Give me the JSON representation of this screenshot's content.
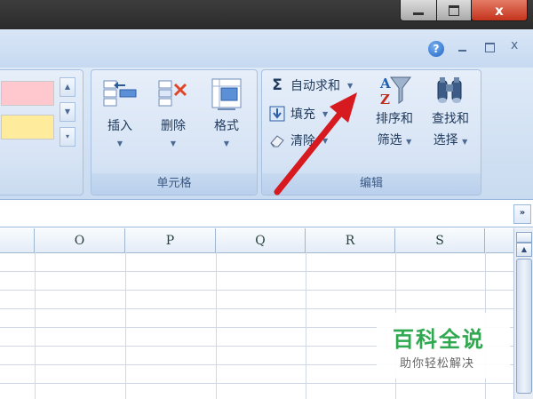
{
  "window": {
    "minimize_icon": "minimize-icon",
    "maximize_icon": "maximize-icon",
    "close_label": "x"
  },
  "doc_controls": {
    "help_label": "?",
    "close_label": "x"
  },
  "ribbon": {
    "cells_group": {
      "label": "单元格",
      "insert": "插入",
      "delete": "删除",
      "format": "格式"
    },
    "edit_group": {
      "label": "编辑",
      "autosum": "自动求和",
      "autosum_symbol": "Σ",
      "fill": "填充",
      "clear": "清除",
      "sort_filter_line1": "排序和",
      "sort_filter_line2": "筛选",
      "find_select_line1": "查找和",
      "find_select_line2": "选择"
    }
  },
  "grid": {
    "columns": [
      "O",
      "P",
      "Q",
      "R",
      "S"
    ]
  },
  "watermark": {
    "title": "百科全说",
    "subtitle": "助你轻松解决"
  },
  "colors": {
    "style_bad": "#ffc7ce",
    "style_neutral": "#ffeb9c",
    "arrow": "#d71920",
    "watermark_green": "#2fa84f"
  }
}
